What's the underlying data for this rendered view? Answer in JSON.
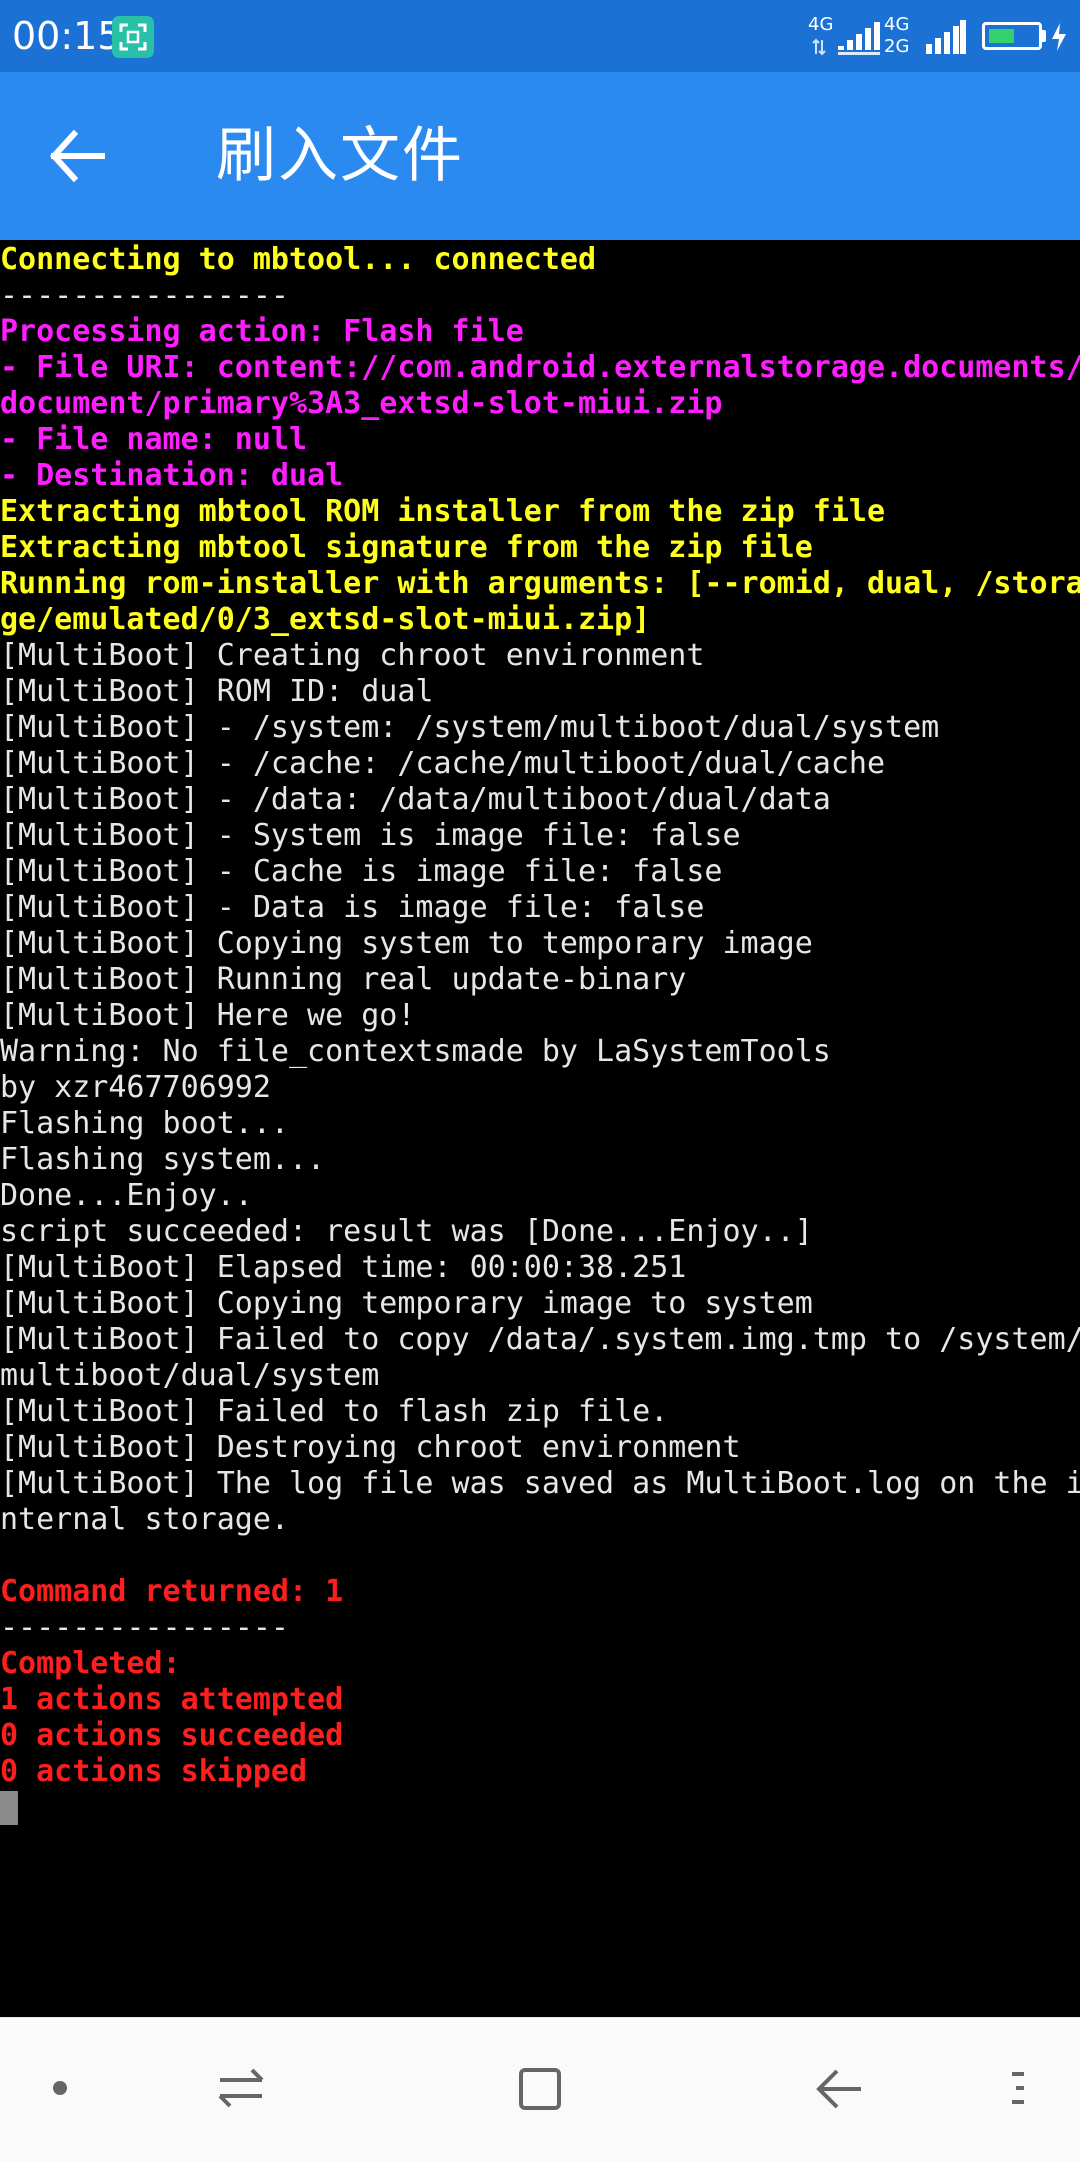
{
  "status_bar": {
    "time": "00:15",
    "network1_top": "4G",
    "network2_top": "4G",
    "network2_bottom": "2G",
    "battery_level": 0.55,
    "battery_color": "#35d06e",
    "icons": [
      "screenshot-scan-icon",
      "signal-icon",
      "battery-icon",
      "charging-icon"
    ]
  },
  "app_bar": {
    "title": "刷入文件",
    "background": "#2a8af0"
  },
  "console": {
    "lines": [
      {
        "text": "Connecting to mbtool... connected",
        "color": "yellow"
      },
      {
        "text": "----------------",
        "color": "white"
      },
      {
        "text": "Processing action: Flash file",
        "color": "magenta"
      },
      {
        "text": "- File URI: content://com.android.externalstorage.documents/",
        "color": "magenta"
      },
      {
        "text": "document/primary%3A3_extsd-slot-miui.zip",
        "color": "magenta"
      },
      {
        "text": "- File name: null",
        "color": "magenta"
      },
      {
        "text": "- Destination: dual",
        "color": "magenta"
      },
      {
        "text": "Extracting mbtool ROM installer from the zip file",
        "color": "yellow"
      },
      {
        "text": "Extracting mbtool signature from the zip file",
        "color": "yellow"
      },
      {
        "text": "Running rom-installer with arguments: [--romid, dual, /stora",
        "color": "yellow"
      },
      {
        "text": "ge/emulated/0/3_extsd-slot-miui.zip]",
        "color": "yellow"
      },
      {
        "text": "[MultiBoot] Creating chroot environment",
        "color": "white"
      },
      {
        "text": "[MultiBoot] ROM ID: dual",
        "color": "white"
      },
      {
        "text": "[MultiBoot] - /system: /system/multiboot/dual/system",
        "color": "white"
      },
      {
        "text": "[MultiBoot] - /cache: /cache/multiboot/dual/cache",
        "color": "white"
      },
      {
        "text": "[MultiBoot] - /data: /data/multiboot/dual/data",
        "color": "white"
      },
      {
        "text": "[MultiBoot] - System is image file: false",
        "color": "white"
      },
      {
        "text": "[MultiBoot] - Cache is image file: false",
        "color": "white"
      },
      {
        "text": "[MultiBoot] - Data is image file: false",
        "color": "white"
      },
      {
        "text": "[MultiBoot] Copying system to temporary image",
        "color": "white"
      },
      {
        "text": "[MultiBoot] Running real update-binary",
        "color": "white"
      },
      {
        "text": "[MultiBoot] Here we go!",
        "color": "white"
      },
      {
        "text": "Warning: No file_contextsmade by LaSystemTools",
        "color": "white"
      },
      {
        "text": "by xzr467706992",
        "color": "white"
      },
      {
        "text": "Flashing boot...",
        "color": "white"
      },
      {
        "text": "Flashing system...",
        "color": "white"
      },
      {
        "text": "Done...Enjoy..",
        "color": "white"
      },
      {
        "text": "script succeeded: result was [Done...Enjoy..]",
        "color": "white"
      },
      {
        "text": "[MultiBoot] Elapsed time: 00:00:38.251",
        "color": "white"
      },
      {
        "text": "[MultiBoot] Copying temporary image to system",
        "color": "white"
      },
      {
        "text": "[MultiBoot] Failed to copy /data/.system.img.tmp to /system/",
        "color": "white"
      },
      {
        "text": "multiboot/dual/system",
        "color": "white"
      },
      {
        "text": "[MultiBoot] Failed to flash zip file.",
        "color": "white"
      },
      {
        "text": "[MultiBoot] Destroying chroot environment",
        "color": "white"
      },
      {
        "text": "[MultiBoot] The log file was saved as MultiBoot.log on the i",
        "color": "white"
      },
      {
        "text": "nternal storage.",
        "color": "white"
      },
      {
        "text": "",
        "color": "white"
      },
      {
        "text": "Command returned: 1",
        "color": "red"
      },
      {
        "text": "----------------",
        "color": "white"
      },
      {
        "text": "Completed:",
        "color": "red"
      },
      {
        "text": "1 actions attempted",
        "color": "red"
      },
      {
        "text": "0 actions succeeded",
        "color": "red"
      },
      {
        "text": "0 actions skipped",
        "color": "red"
      }
    ]
  },
  "nav_bar": {
    "buttons": [
      "dot-menu-icon",
      "switch-icon",
      "home-square-icon",
      "back-arrow-icon",
      "more-icon"
    ]
  }
}
